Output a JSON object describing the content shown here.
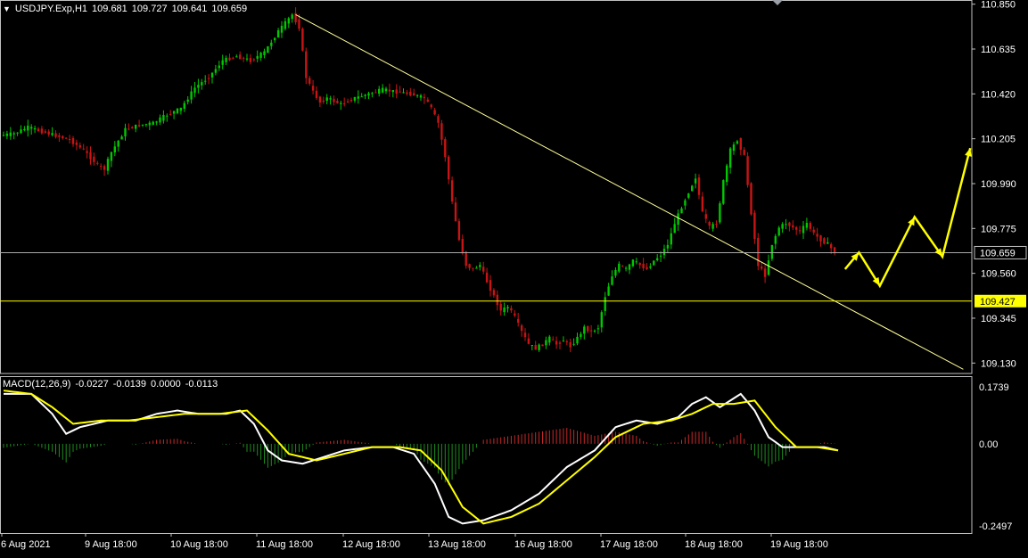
{
  "header": {
    "symbol_label": "USDJPY.Exp,H1",
    "open": "109.681",
    "high": "109.727",
    "low": "109.641",
    "close": "109.659",
    "menu_icon": "triangle-down-icon"
  },
  "colors": {
    "background": "#000000",
    "bull_candle": "#00c800",
    "bear_candle": "#c81414",
    "trend_line": "#ffff99",
    "forecast_arrow": "#ffff00",
    "macd_line": "#ffffff",
    "signal_line": "#ffff00",
    "hist_positive": "#c82828",
    "hist_negative": "#1e8c1e",
    "price_line": "#aaaaaa",
    "level_line": "#ffff00",
    "frame": "#c0c0c0"
  },
  "chart_data": [
    {
      "type": "candlestick",
      "x_ticks": [
        "6 Aug 2021",
        "9 Aug 18:00",
        "10 Aug 18:00",
        "11 Aug 18:00",
        "12 Aug 18:00",
        "13 Aug 18:00",
        "16 Aug 18:00",
        "17 Aug 18:00",
        "18 Aug 18:00",
        "19 Aug 18:00"
      ],
      "y_ticks": [
        "110.850",
        "110.635",
        "110.420",
        "110.205",
        "109.990",
        "109.775",
        "109.560",
        "109.345",
        "109.130"
      ],
      "ylim": [
        109.08,
        110.87
      ],
      "price_path": [
        [
          0,
          110.22
        ],
        [
          4,
          110.23
        ],
        [
          8,
          110.26
        ],
        [
          12,
          110.24
        ],
        [
          16,
          110.22
        ],
        [
          20,
          110.2
        ],
        [
          24,
          110.15
        ],
        [
          28,
          110.08
        ],
        [
          30,
          110.06
        ],
        [
          32,
          110.14
        ],
        [
          36,
          110.25
        ],
        [
          40,
          110.27
        ],
        [
          44,
          110.28
        ],
        [
          48,
          110.32
        ],
        [
          52,
          110.35
        ],
        [
          56,
          110.45
        ],
        [
          60,
          110.5
        ],
        [
          64,
          110.58
        ],
        [
          68,
          110.6
        ],
        [
          72,
          110.58
        ],
        [
          76,
          110.62
        ],
        [
          80,
          110.72
        ],
        [
          84,
          110.8
        ],
        [
          86,
          110.74
        ],
        [
          88,
          110.5
        ],
        [
          90,
          110.43
        ],
        [
          92,
          110.38
        ],
        [
          94,
          110.4
        ],
        [
          98,
          110.37
        ],
        [
          102,
          110.4
        ],
        [
          106,
          110.42
        ],
        [
          110,
          110.44
        ],
        [
          114,
          110.43
        ],
        [
          118,
          110.42
        ],
        [
          122,
          110.4
        ],
        [
          124,
          110.35
        ],
        [
          126,
          110.28
        ],
        [
          128,
          110.12
        ],
        [
          130,
          109.9
        ],
        [
          132,
          109.72
        ],
        [
          134,
          109.6
        ],
        [
          136,
          109.58
        ],
        [
          138,
          109.6
        ],
        [
          140,
          109.52
        ],
        [
          142,
          109.45
        ],
        [
          144,
          109.38
        ],
        [
          146,
          109.4
        ],
        [
          148,
          109.35
        ],
        [
          150,
          109.28
        ],
        [
          152,
          109.22
        ],
        [
          154,
          109.2
        ],
        [
          156,
          109.22
        ],
        [
          158,
          109.25
        ],
        [
          160,
          109.22
        ],
        [
          162,
          109.24
        ],
        [
          164,
          109.21
        ],
        [
          166,
          109.25
        ],
        [
          168,
          109.3
        ],
        [
          170,
          109.28
        ],
        [
          172,
          109.3
        ],
        [
          174,
          109.45
        ],
        [
          176,
          109.55
        ],
        [
          178,
          109.6
        ],
        [
          180,
          109.58
        ],
        [
          182,
          109.62
        ],
        [
          184,
          109.6
        ],
        [
          186,
          109.58
        ],
        [
          188,
          109.62
        ],
        [
          190,
          109.65
        ],
        [
          192,
          109.7
        ],
        [
          194,
          109.8
        ],
        [
          196,
          109.88
        ],
        [
          198,
          109.95
        ],
        [
          200,
          110.02
        ],
        [
          202,
          109.85
        ],
        [
          204,
          109.78
        ],
        [
          206,
          109.8
        ],
        [
          208,
          110.0
        ],
        [
          210,
          110.15
        ],
        [
          212,
          110.2
        ],
        [
          214,
          110.12
        ],
        [
          216,
          109.85
        ],
        [
          218,
          109.6
        ],
        [
          220,
          109.55
        ],
        [
          222,
          109.7
        ],
        [
          224,
          109.78
        ],
        [
          226,
          109.8
        ],
        [
          228,
          109.78
        ],
        [
          230,
          109.76
        ],
        [
          232,
          109.8
        ],
        [
          234,
          109.75
        ],
        [
          236,
          109.72
        ],
        [
          238,
          109.7
        ],
        [
          240,
          109.66
        ]
      ],
      "trend_line": {
        "from": [
          84,
          110.8
        ],
        "to": [
          276,
          109.1
        ]
      },
      "current_price": {
        "value": 109.659,
        "label": "109.659"
      },
      "level": {
        "value": 109.427,
        "label": "109.427"
      },
      "forecast_path": [
        [
          242,
          109.58
        ],
        [
          246,
          109.66
        ],
        [
          252,
          109.5
        ],
        [
          262,
          109.83
        ],
        [
          270,
          109.64
        ],
        [
          278,
          110.16
        ]
      ]
    },
    {
      "type": "macd",
      "params": "MACD(12,26,9)",
      "values": [
        "-0.0227",
        "-0.0139",
        "0.0000",
        "-0.0113"
      ],
      "y_ticks": [
        "0.1739",
        "0.00",
        "-0.2497"
      ],
      "ylim": [
        -0.2497,
        0.1739
      ],
      "macd_path": [
        [
          0,
          0.15
        ],
        [
          8,
          0.15
        ],
        [
          14,
          0.09
        ],
        [
          18,
          0.03
        ],
        [
          22,
          0.05
        ],
        [
          30,
          0.07
        ],
        [
          38,
          0.07
        ],
        [
          44,
          0.09
        ],
        [
          50,
          0.1
        ],
        [
          56,
          0.09
        ],
        [
          64,
          0.09
        ],
        [
          68,
          0.1
        ],
        [
          72,
          0.06
        ],
        [
          76,
          -0.02
        ],
        [
          80,
          -0.05
        ],
        [
          86,
          -0.06
        ],
        [
          92,
          -0.04
        ],
        [
          98,
          -0.02
        ],
        [
          106,
          -0.01
        ],
        [
          112,
          -0.01
        ],
        [
          118,
          -0.03
        ],
        [
          124,
          -0.12
        ],
        [
          128,
          -0.22
        ],
        [
          132,
          -0.24
        ],
        [
          138,
          -0.23
        ],
        [
          146,
          -0.2
        ],
        [
          154,
          -0.15
        ],
        [
          162,
          -0.07
        ],
        [
          170,
          -0.02
        ],
        [
          176,
          0.05
        ],
        [
          182,
          0.07
        ],
        [
          188,
          0.06
        ],
        [
          194,
          0.08
        ],
        [
          198,
          0.12
        ],
        [
          202,
          0.14
        ],
        [
          206,
          0.11
        ],
        [
          212,
          0.15
        ],
        [
          216,
          0.1
        ],
        [
          220,
          0.02
        ],
        [
          224,
          -0.01
        ],
        [
          230,
          -0.01
        ],
        [
          236,
          -0.01
        ],
        [
          240,
          -0.02
        ]
      ],
      "signal_path": [
        [
          0,
          0.16
        ],
        [
          8,
          0.15
        ],
        [
          14,
          0.11
        ],
        [
          20,
          0.06
        ],
        [
          28,
          0.07
        ],
        [
          36,
          0.07
        ],
        [
          44,
          0.08
        ],
        [
          52,
          0.09
        ],
        [
          62,
          0.09
        ],
        [
          70,
          0.1
        ],
        [
          76,
          0.04
        ],
        [
          82,
          -0.03
        ],
        [
          90,
          -0.05
        ],
        [
          98,
          -0.03
        ],
        [
          106,
          -0.01
        ],
        [
          114,
          -0.01
        ],
        [
          120,
          -0.02
        ],
        [
          126,
          -0.08
        ],
        [
          132,
          -0.19
        ],
        [
          138,
          -0.24
        ],
        [
          146,
          -0.22
        ],
        [
          154,
          -0.18
        ],
        [
          162,
          -0.11
        ],
        [
          170,
          -0.04
        ],
        [
          176,
          0.02
        ],
        [
          184,
          0.06
        ],
        [
          192,
          0.07
        ],
        [
          198,
          0.09
        ],
        [
          204,
          0.12
        ],
        [
          210,
          0.12
        ],
        [
          216,
          0.13
        ],
        [
          222,
          0.05
        ],
        [
          228,
          -0.01
        ],
        [
          234,
          -0.01
        ],
        [
          240,
          -0.02
        ]
      ]
    }
  ]
}
